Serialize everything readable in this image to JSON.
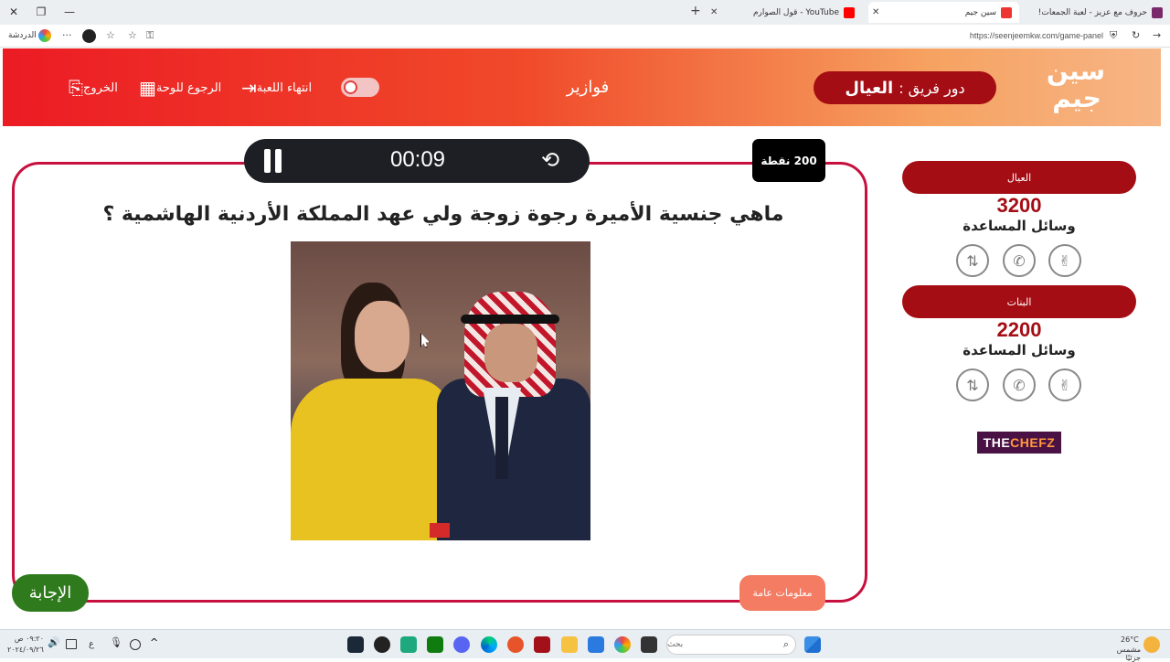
{
  "browser": {
    "tabs": [
      {
        "title": "حروف مع عزيز - لعبة الجمعات!",
        "active": false,
        "favicon_color": "#7a2a6a"
      },
      {
        "title": "سين جيم",
        "active": true,
        "favicon_color": "#e33"
      },
      {
        "title": "YouTube - قول الصوارم",
        "active": false,
        "favicon_color": "#f00"
      }
    ],
    "url": "https://seenjeemkw.com/game-panel",
    "chat_label": "الدردشة"
  },
  "header": {
    "logo_text": "سين جيم",
    "turn_prefix": "دور فريق :",
    "turn_team": "العيال",
    "game_title": "فوازير",
    "end_game_label": "انتهاء اللعبة",
    "back_to_board_label": "الرجوع للوحة",
    "exit_label": "الخروج"
  },
  "question": {
    "timer": "00:09",
    "points": "200 نقطة",
    "text": "ماهي جنسية الأميرة رجوة زوجة ولي عهد المملكة الأردنية الهاشمية ؟",
    "category": "معلومات عامة",
    "answer_button": "الإجابة"
  },
  "teams": [
    {
      "name": "العيال",
      "score": "3200",
      "aids_label": "وسائل المساعدة"
    },
    {
      "name": "البنات",
      "score": "2200",
      "aids_label": "وسائل المساعدة"
    }
  ],
  "sponsor": {
    "text_main": "THE ",
    "text_accent": "CHEFZ"
  },
  "taskbar": {
    "search_placeholder": "بحث",
    "time": "٠٩:٢٠ ص",
    "date": "٢٠٢٤/٠٩/٢٦",
    "weather_temp": "26°C",
    "weather_desc": "مشمس جزئيًا",
    "lang": "ع"
  }
}
